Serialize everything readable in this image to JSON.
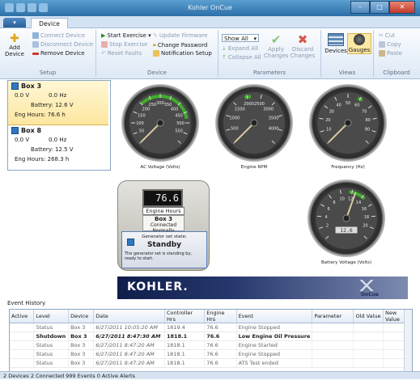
{
  "window": {
    "title": "Kohler OnCue",
    "min": "–",
    "max": "□",
    "close": "✕"
  },
  "tabs": {
    "app_button": "▾",
    "device": "Device"
  },
  "ribbon": {
    "setup": {
      "label": "Setup",
      "add_device": "Add\nDevice",
      "connect": "Connect Device",
      "disconnect": "Disconnect Device",
      "remove": "Remove Device"
    },
    "device": {
      "label": "Device",
      "start_exercise": "Start Exercise ▾",
      "stop_exercise": "Stop Exercise",
      "reset_faults": "Reset Faults",
      "update_firmware": "Update Firmware",
      "change_password": "Change Password",
      "notification_setup": "Notification Setup"
    },
    "parameters": {
      "label": "Parameters",
      "show_all": "Show All",
      "expand_all": "Expand All",
      "collapse_all": "Collapse All",
      "apply": "Apply\nChanges",
      "discard": "Discard\nChanges"
    },
    "views": {
      "label": "Views",
      "devices": "Devices",
      "gauges": "Gauges"
    },
    "clipboard": {
      "label": "Clipboard",
      "cut": "Cut",
      "copy": "Copy",
      "paste": "Paste"
    }
  },
  "devices": [
    {
      "name": "Box 3",
      "voltage": "0.0 V",
      "freq": "0.0 Hz",
      "battery": "Battery: 12.6 V",
      "eng_hours": "Eng Hours: 76.6 h"
    },
    {
      "name": "Box 8",
      "voltage": "0.0 V",
      "freq": "0.0 Hz",
      "battery": "Battery: 12.5 V",
      "eng_hours": "Eng Hours: 268.3 h"
    }
  ],
  "gauges": {
    "ac_voltage": {
      "label": "AC Voltage (Volts)",
      "ticks": [
        "50",
        "100",
        "150",
        "200",
        "250",
        "300",
        "350",
        "400",
        "450",
        "500",
        "550"
      ],
      "value": 0,
      "max": 600,
      "green": [
        200,
        480
      ]
    },
    "engine_rpm": {
      "label": "Engine RPM",
      "ticks": [
        "500",
        "1000",
        "1500",
        "2000",
        "2500",
        "3000",
        "3500",
        "4000"
      ],
      "value": 0,
      "max": 4000,
      "green": [
        1700,
        1900
      ]
    },
    "frequency": {
      "label": "Frequency (Hz)",
      "ticks": [
        "10",
        "20",
        "30",
        "40",
        "50",
        "60",
        "70",
        "80",
        "90"
      ],
      "value": 0,
      "max": 100,
      "green": [
        58,
        62
      ]
    },
    "battery": {
      "label": "Battery Voltage (Volts)",
      "ticks": [
        "2",
        "4",
        "6",
        "8",
        "10",
        "12",
        "14",
        "16",
        "18",
        "20"
      ],
      "value": 12.6,
      "max": 22,
      "green": [
        11.5,
        14.5
      ],
      "readout": "12.6"
    }
  },
  "engine": {
    "hours_display": "76.6",
    "hours_label": "Engine Hours",
    "box_name": "Box 3",
    "box_status": "Connected Normally"
  },
  "gen_state": {
    "caption": "Generator set state:",
    "state": "Standby",
    "desc": "The generator set is standing by, ready to start."
  },
  "brand": {
    "kohler": "KOHLER.",
    "oncue": "OnCue"
  },
  "events": {
    "header": "Event History",
    "columns": [
      "Active",
      "Level",
      "Device",
      "Date",
      "Controller Hrs",
      "Engine Hrs",
      "Event",
      "Parameter",
      "Old Value",
      "New Value"
    ],
    "rows": [
      [
        "",
        "Status",
        "Box 3",
        "6/27/2011 10:05:20 AM",
        "1819.4",
        "76.6",
        "Engine Stopped",
        "",
        "",
        ""
      ],
      [
        "",
        "Shutdown",
        "Box 3",
        "6/27/2011 8:47:30 AM",
        "1818.1",
        "76.6",
        "Low Engine Oil Pressure",
        "",
        "",
        ""
      ],
      [
        "",
        "Status",
        "Box 3",
        "6/27/2011 8:47:20 AM",
        "1818.1",
        "76.6",
        "Engine Started",
        "",
        "",
        ""
      ],
      [
        "",
        "Status",
        "Box 3",
        "6/27/2011 8:47:20 AM",
        "1818.1",
        "76.6",
        "Engine Stopped",
        "",
        "",
        ""
      ],
      [
        "",
        "Status",
        "Box 3",
        "6/27/2011 8:47:20 AM",
        "1818.1",
        "76.6",
        "ATS Test ended",
        "",
        "",
        ""
      ]
    ]
  },
  "status": {
    "text": "2 Devices  2 Connected  999 Events  0 Active Alerts"
  },
  "colors": {
    "accent": "#2f78c0",
    "gauge_green": "#3fae2a",
    "title_blue": "#2d6fa8"
  }
}
